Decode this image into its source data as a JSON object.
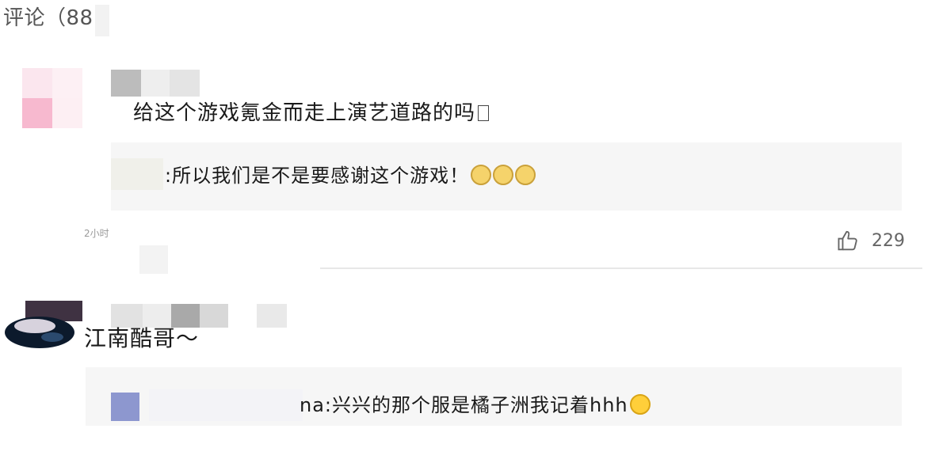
{
  "header": {
    "title": "评论（88"
  },
  "comments": [
    {
      "text": "给这个游戏氪金而走上演艺道路的吗",
      "reply": {
        "text": ":所以我们是不是要感谢这个游戏！",
        "emojis": [
          "dog-face-emoji",
          "dog-face-emoji",
          "dog-face-emoji"
        ]
      },
      "time": "2小时",
      "likes": "229",
      "like_icon": "thumbs-up-icon"
    },
    {
      "text": "江南酷哥～",
      "reply": {
        "text": "na:兴兴的那个服是橘子洲我记着hhh",
        "emojis": [
          "laughing-emoji"
        ]
      }
    }
  ],
  "colors": {
    "text": "#1a1a1a",
    "muted": "#666666",
    "reply_bg": "#f6f6f6",
    "divider": "#e7e7e7"
  }
}
